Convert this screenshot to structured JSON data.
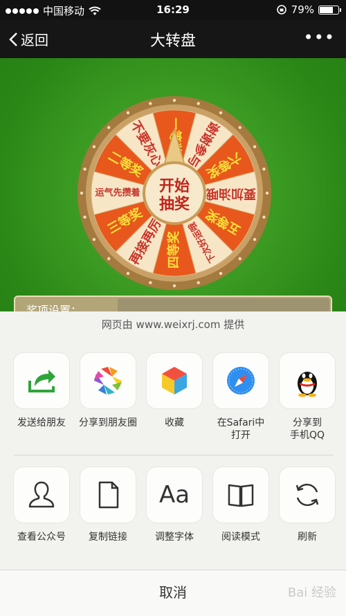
{
  "status_bar": {
    "carrier": "中国移动",
    "time": "16:29",
    "battery": "79%",
    "battery_level": 0.79
  },
  "nav": {
    "back_label": "返回",
    "title": "大转盘",
    "more": "•••"
  },
  "wheel": {
    "center_text_line1": "开始",
    "center_text_line2": "抽奖",
    "segments": [
      "一等奖",
      "谢谢参与",
      "六等奖",
      "要加油哦",
      "五等奖",
      "下次好运哦",
      "四等奖",
      "再接再厉",
      "三等奖",
      "运气先攒着",
      "二等奖",
      "不要灰心"
    ],
    "colors": {
      "orange": "#e8581c",
      "cream": "#f7e6c6",
      "rim": "#c9a166"
    }
  },
  "settings": {
    "label": "奖项设置："
  },
  "share_sheet": {
    "header": "网页由 www.weixrj.com 提供",
    "row1": [
      {
        "label": "发送给朋友",
        "icon": "send-to-friend-icon"
      },
      {
        "label": "分享到朋友圈",
        "icon": "moments-icon"
      },
      {
        "label": "收藏",
        "icon": "favorites-cube-icon"
      },
      {
        "label_line1": "在Safari中",
        "label_line2": "打开",
        "icon": "safari-compass-icon"
      },
      {
        "label_line1": "分享到",
        "label_line2": "手机QQ",
        "icon": "qq-penguin-icon"
      }
    ],
    "row2": [
      {
        "label": "查看公众号",
        "icon": "profile-icon"
      },
      {
        "label": "复制链接",
        "icon": "document-icon"
      },
      {
        "label": "调整字体",
        "icon": "font-icon",
        "glyph": "Aa"
      },
      {
        "label": "阅读模式",
        "icon": "book-icon"
      },
      {
        "label": "刷新",
        "icon": "refresh-icon"
      }
    ],
    "cancel": "取消"
  },
  "watermark": "Bai 经验"
}
